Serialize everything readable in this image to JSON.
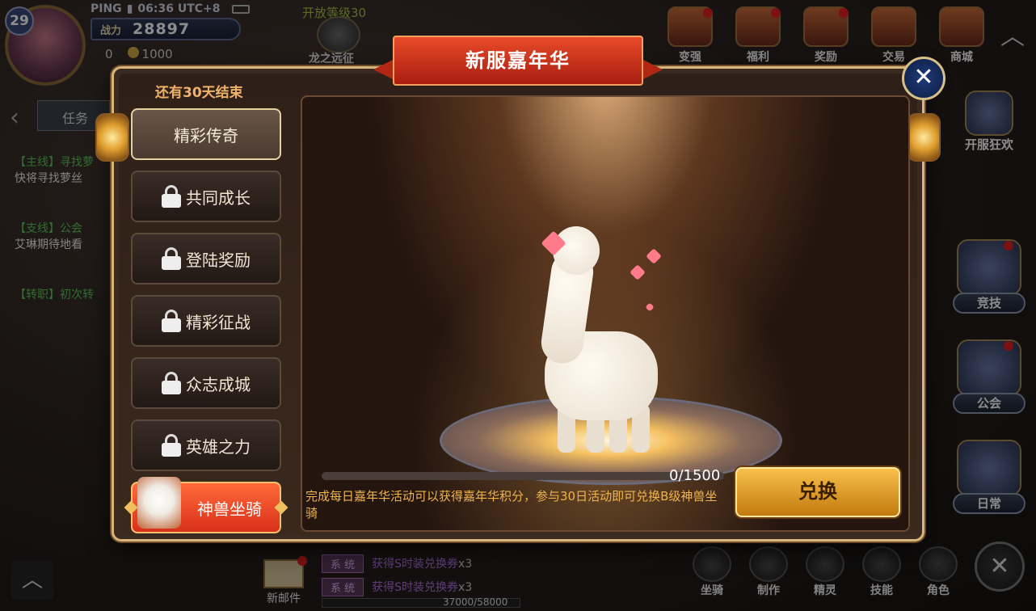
{
  "hud": {
    "level": "29",
    "status": {
      "ping": "PING",
      "time": "06:36 UTC+8"
    },
    "power_label": "战力",
    "power_value": "28897",
    "resources": {
      "a": "0",
      "coins": "1000"
    },
    "unlock_text": "开放等级30",
    "dragon_label": "龙之远征",
    "top_icons": [
      "变强",
      "福利",
      "奖励",
      "交易",
      "商城"
    ],
    "side_event_label": "开服狂欢",
    "side_buttons": [
      "竞技",
      "公会",
      "日常"
    ],
    "quest": {
      "tab_label": "任务",
      "lines": [
        {
          "tag": "【主线】寻找萝",
          "text": "快将寻找萝丝"
        },
        {
          "tag": "【支线】公会",
          "text": "艾琳期待地看"
        },
        {
          "tag": "【转职】初次转",
          "text": ""
        }
      ]
    },
    "mail_label": "新邮件",
    "chat": [
      {
        "tag": "系 统",
        "msg": "获得S时装兑换券",
        "count": "x3"
      },
      {
        "tag": "系 统",
        "msg": "获得S时装兑换券",
        "count": "x3"
      }
    ],
    "exp_text": "37000/58000",
    "bottom_icons": [
      "坐骑",
      "制作",
      "精灵",
      "技能",
      "角色"
    ]
  },
  "event": {
    "title": "新服嘉年华",
    "countdown": "还有30天结束",
    "tabs": [
      {
        "label": "精彩传奇",
        "locked": false,
        "active": true
      },
      {
        "label": "共同成长",
        "locked": true
      },
      {
        "label": "登陆奖励",
        "locked": true
      },
      {
        "label": "精彩征战",
        "locked": true
      },
      {
        "label": "众志成城",
        "locked": true
      },
      {
        "label": "英雄之力",
        "locked": true
      },
      {
        "label": "神兽坐骑",
        "locked": false,
        "special": true
      }
    ],
    "progress_text": "0/1500",
    "progress_fraction": 0,
    "description": "完成每日嘉年华活动可以获得嘉年华积分，参与30日活动即可兑换B级神兽坐骑",
    "exchange_label": "兑换",
    "close_label": "✕"
  }
}
